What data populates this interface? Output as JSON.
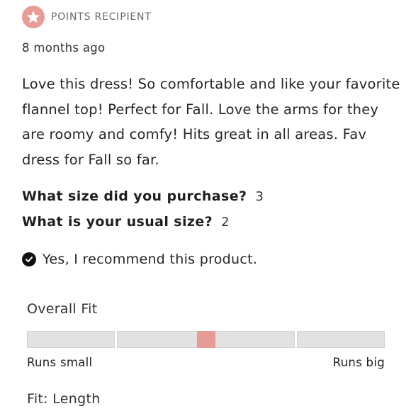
{
  "badge": {
    "icon": "star-icon",
    "label": "POINTS RECIPIENT",
    "color": "#e79c95"
  },
  "review": {
    "timestamp": "8 months ago",
    "body": "Love this dress! So comfortable and like your favorite flannel top! Perfect for Fall. Love the arms for they are roomy and comfy! Hits great in all areas. Fav dress for Fall so far.",
    "questions": [
      {
        "question": "What size did you purchase?",
        "answer": "3"
      },
      {
        "question": "What is your usual size?",
        "answer": "2"
      }
    ],
    "recommend": {
      "icon": "check-circle-icon",
      "label": "Yes, I recommend this product."
    }
  },
  "fit": {
    "overall": {
      "title": "Overall Fit",
      "min_label": "Runs small",
      "max_label": "Runs big",
      "value": 0.5,
      "marker_color": "#e69b95",
      "segments": 4
    },
    "length_title": "Fit: Length"
  }
}
